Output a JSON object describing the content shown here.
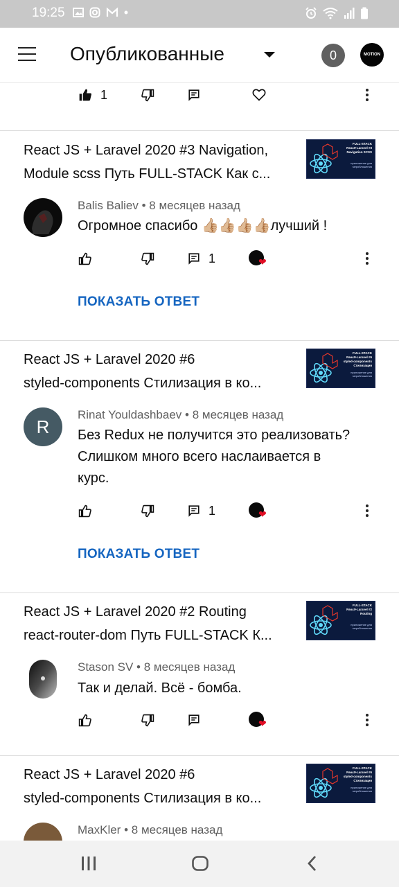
{
  "status_bar": {
    "time": "19:25",
    "icons": [
      "gallery-icon",
      "instagram-icon",
      "gmail-icon",
      "dot-icon",
      "alarm-icon",
      "wifi-icon",
      "signal-icon",
      "battery-icon"
    ]
  },
  "app_bar": {
    "title": "Опубликованные",
    "count": "0",
    "avatar_text": "MOTION"
  },
  "top_actions": {
    "like_count": "1"
  },
  "comments": [
    {
      "video_title_line1": "React JS + Laravel 2020 #3 Navigation,",
      "video_title_line2": "Module scss Путь FULL-STACK Как с...",
      "thumb_title": "FULL-STACK React+Laravel #3 Navigation SCSS",
      "thumb_sub": "приложение для мероблошения",
      "author": "Balis Baliev",
      "time": "8 месяцев назад",
      "text": "Огромное спасибо 👍🏼👍🏼👍🏼👍🏼лучший !",
      "reply_count": "1",
      "show_reply": "ПОКАЗАТЬ ОТВЕТ"
    },
    {
      "video_title_line1": "React JS + Laravel 2020 #6",
      "video_title_line2": "styled-components Стилизация в ко...",
      "thumb_title": "FULL-STACK React+Laravel #6 styled-components Стилизация",
      "thumb_sub": "приложение для мероблошения",
      "author": "Rinat Youldashbaev",
      "avatar_letter": "R",
      "time": "8 месяцев назад",
      "text": "Без Redux не получится это реализовать? Слишком много всего наслаивается в курс.",
      "reply_count": "1",
      "show_reply": "ПОКАЗАТЬ ОТВЕТ"
    },
    {
      "video_title_line1": "React JS + Laravel 2020 #2 Routing",
      "video_title_line2": "react-router-dom Путь FULL-STACK К...",
      "thumb_title": "FULL-STACK React+Laravel #2 Routing",
      "thumb_sub": "приложение для мероблошения",
      "author": "Stason SV",
      "time": "8 месяцев назад",
      "text": "Так и делай. Всё  -  бомба."
    },
    {
      "video_title_line1": "React JS + Laravel 2020 #6",
      "video_title_line2": "styled-components Стилизация в ко...",
      "thumb_title": "FULL-STACK React+Laravel #6 styled-components Стилизация",
      "thumb_sub": "приложение для мероблошения",
      "author": "MaxKler",
      "time": "8 месяцев назад"
    }
  ],
  "colors": {
    "link_blue": "#1565c0",
    "heart_red": "#e10e25",
    "meta_gray": "#606060"
  },
  "nav_bar": {
    "icons": [
      "recent-apps-icon",
      "home-icon",
      "back-icon"
    ]
  }
}
